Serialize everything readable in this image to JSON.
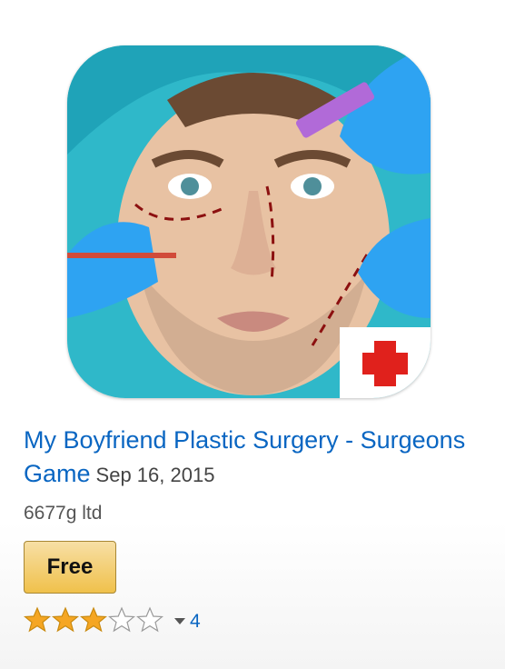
{
  "app": {
    "title": "My Boyfriend Plastic Surgery - Surgeons Game",
    "date": "Sep 16, 2015",
    "publisher": "6677g ltd",
    "price_label": "Free",
    "rating": {
      "stars_filled": 3,
      "stars_total": 5,
      "review_count": "4"
    }
  },
  "icons": {
    "app_icon": "surgery-face-app-icon",
    "star": "star-icon",
    "caret": "caret-down-icon"
  },
  "colors": {
    "link": "#0a66c2",
    "button_bg": "#f0c14b",
    "star_fill": "#f5a623",
    "medical_cross": "#e0211c"
  }
}
